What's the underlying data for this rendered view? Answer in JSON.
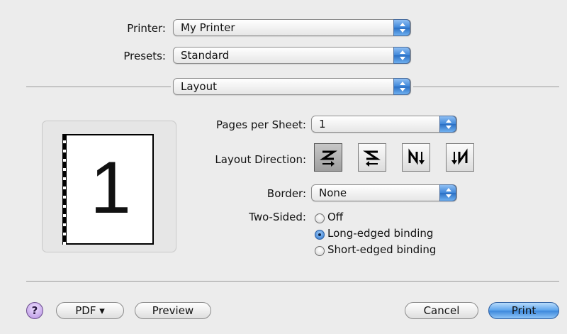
{
  "printer": {
    "label": "Printer:",
    "value": "My Printer"
  },
  "presets": {
    "label": "Presets:",
    "value": "Standard"
  },
  "panel": {
    "value": "Layout"
  },
  "preview": {
    "page_number": "1"
  },
  "layout": {
    "pages_per_sheet": {
      "label": "Pages per Sheet:",
      "value": "1"
    },
    "direction": {
      "label": "Layout Direction:",
      "options": [
        "z-icon",
        "reverse-z-icon",
        "n-down-icon",
        "reverse-n-down-icon"
      ],
      "selected_index": 0
    },
    "border": {
      "label": "Border:",
      "value": "None"
    },
    "two_sided": {
      "label": "Two-Sided:",
      "options": [
        "Off",
        "Long-edged binding",
        "Short-edged binding"
      ],
      "selected": "Long-edged binding"
    }
  },
  "buttons": {
    "help": "?",
    "pdf": "PDF ▾",
    "preview": "Preview",
    "cancel": "Cancel",
    "print": "Print"
  },
  "colors": {
    "accent": "#3b86dc",
    "background": "#ececec"
  }
}
